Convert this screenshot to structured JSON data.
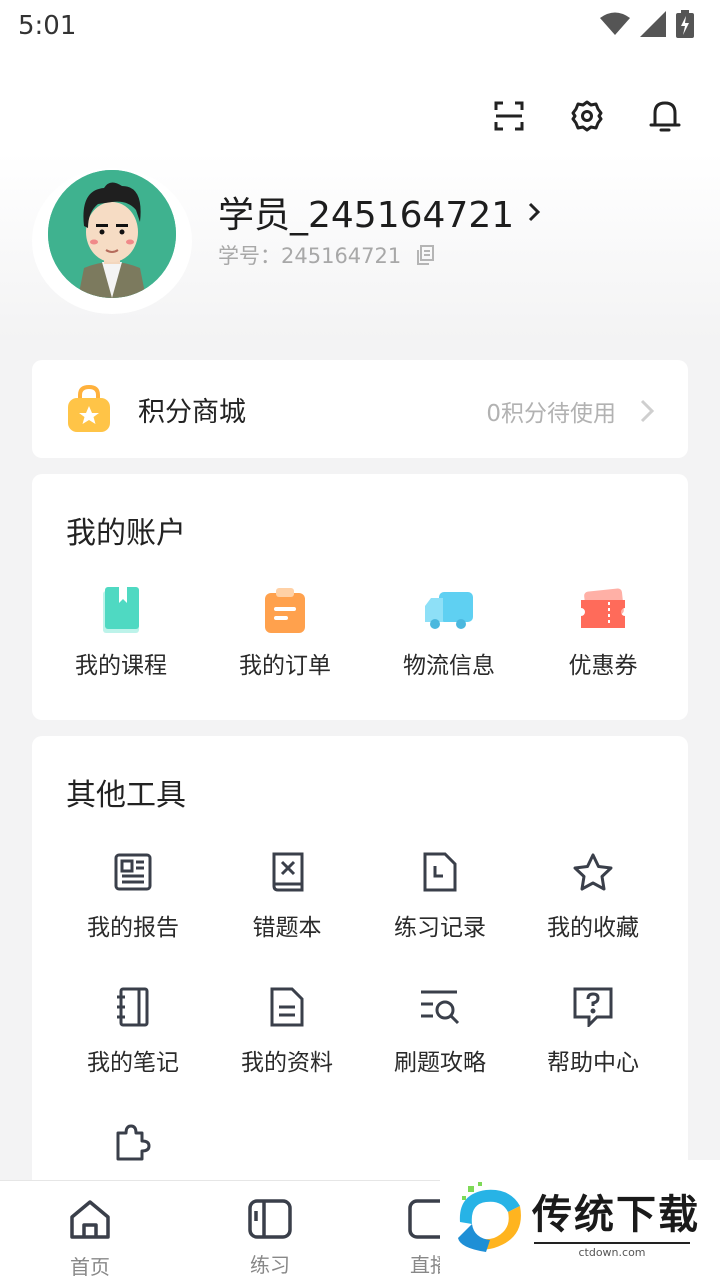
{
  "status_bar": {
    "time": "5:01"
  },
  "user": {
    "name": "学员_245164721",
    "id_label": "学号：245164721"
  },
  "points": {
    "title": "积分商城",
    "status": "0积分待使用"
  },
  "account": {
    "title": "我的账户",
    "items": [
      {
        "label": "我的课程",
        "icon": "course-book-icon"
      },
      {
        "label": "我的订单",
        "icon": "order-clipboard-icon"
      },
      {
        "label": "物流信息",
        "icon": "delivery-truck-icon"
      },
      {
        "label": "优惠券",
        "icon": "coupon-ticket-icon"
      }
    ]
  },
  "tools": {
    "title": "其他工具",
    "items": [
      {
        "label": "我的报告",
        "icon": "report-icon"
      },
      {
        "label": "错题本",
        "icon": "wrong-answer-book-icon"
      },
      {
        "label": "练习记录",
        "icon": "practice-record-icon"
      },
      {
        "label": "我的收藏",
        "icon": "star-icon"
      },
      {
        "label": "我的笔记",
        "icon": "notebook-icon"
      },
      {
        "label": "我的资料",
        "icon": "document-icon"
      },
      {
        "label": "刷题攻略",
        "icon": "search-list-icon"
      },
      {
        "label": "帮助中心",
        "icon": "help-icon"
      },
      {
        "label": "",
        "icon": "puzzle-icon"
      }
    ]
  },
  "bottom_nav": [
    {
      "label": "首页",
      "icon": "home-icon"
    },
    {
      "label": "练习",
      "icon": "practice-icon"
    },
    {
      "label": "直播",
      "icon": "live-icon"
    }
  ],
  "watermark": {
    "title": "传统下载",
    "site": "ctdown.com"
  },
  "colors": {
    "avatar_bg": "#3fb28f",
    "icon_dark": "#3a3f4a",
    "course_teal": "#4fd9c2",
    "order_orange": "#ffa14d",
    "truck_blue": "#5fd0f2",
    "coupon_red": "#ff6b5a"
  }
}
